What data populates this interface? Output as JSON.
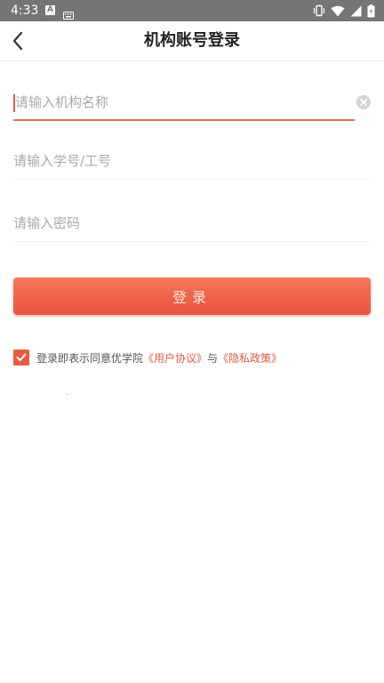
{
  "status_bar": {
    "time": "4:33",
    "a_icon_letter": "A",
    "left_icons": [
      "a-notification-icon",
      "keyboard-icon"
    ],
    "right_icons": [
      "vibrate-icon",
      "wifi-icon",
      "signal-icon",
      "battery-icon"
    ]
  },
  "header": {
    "title": "机构账号登录",
    "back_icon": "chevron-left-icon"
  },
  "form": {
    "institution_placeholder": "请输入机构名称",
    "institution_value": "",
    "id_placeholder": "请输入学号/工号",
    "id_value": "",
    "password_placeholder": "请输入密码",
    "password_value": "",
    "login_label": "登录"
  },
  "agreement": {
    "checked": true,
    "prefix": "登录即表示同意优学院",
    "user_agreement": "《用户协议》",
    "connector": "与",
    "privacy_policy": "《隐私政策》"
  },
  "colors": {
    "status_bar_bg": "#757575",
    "accent": "#e9523f",
    "link": "#e05a43"
  }
}
